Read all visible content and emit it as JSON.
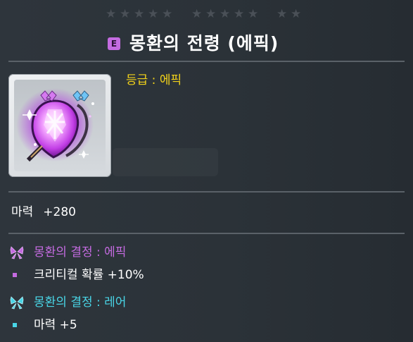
{
  "tooltip": {
    "stars": [
      "★",
      "★",
      "★",
      "★",
      "★",
      "★",
      "★",
      "★",
      "★",
      "★",
      "★",
      "★"
    ],
    "rank_badge": "E",
    "title": "몽환의 전령 (에픽)",
    "grade_text": "등급 : 에픽",
    "item_icon": "dreamy-herald-heart-icon",
    "stat_label": "마력",
    "stat_value": "+280",
    "potentials": [
      {
        "header": "몽환의 결정 : 에픽",
        "line": "크리티컬 확률 +10%",
        "icon": "purple-butterfly-icon"
      },
      {
        "header": "몽환의 결정 : 레어",
        "line": "마력 +5",
        "icon": "cyan-butterfly-icon"
      }
    ]
  },
  "colors": {
    "background": "#2a3036",
    "grade_yellow": "#f2d21a",
    "epic_purple": "#c46be0",
    "rare_cyan": "#49d5e6",
    "divider": "#5a6168",
    "star_inactive": "#4a5057"
  }
}
